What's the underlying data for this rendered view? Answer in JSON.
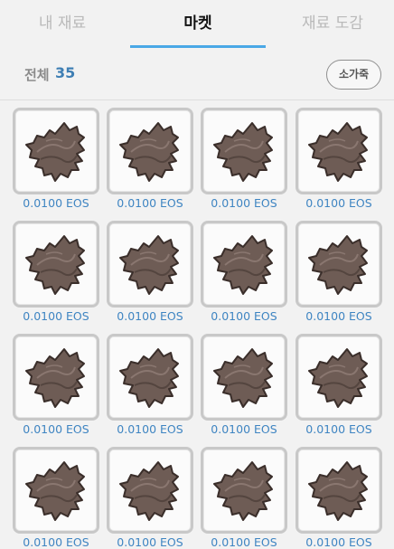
{
  "tabs": [
    {
      "label": "내 재료",
      "active": false
    },
    {
      "label": "마켓",
      "active": true
    },
    {
      "label": "재료 도감",
      "active": false
    }
  ],
  "summary": {
    "total_label": "전체",
    "total_count": "35",
    "sort_label": "소가죽"
  },
  "item_icon": "leather-hide-icon",
  "colors": {
    "accent": "#4aa8e6",
    "price": "#3f85c2",
    "count": "#3f7fb4",
    "hide": "#6e5c55"
  },
  "items": [
    {
      "price": "0.0100 EOS"
    },
    {
      "price": "0.0100 EOS"
    },
    {
      "price": "0.0100 EOS"
    },
    {
      "price": "0.0100 EOS"
    },
    {
      "price": "0.0100 EOS"
    },
    {
      "price": "0.0100 EOS"
    },
    {
      "price": "0.0100 EOS"
    },
    {
      "price": "0.0100 EOS"
    },
    {
      "price": "0.0100 EOS"
    },
    {
      "price": "0.0100 EOS"
    },
    {
      "price": "0.0100 EOS"
    },
    {
      "price": "0.0100 EOS"
    },
    {
      "price": "0.0100 EOS"
    },
    {
      "price": "0.0100 EOS"
    },
    {
      "price": "0.0100 EOS"
    },
    {
      "price": "0.0100 EOS"
    }
  ]
}
